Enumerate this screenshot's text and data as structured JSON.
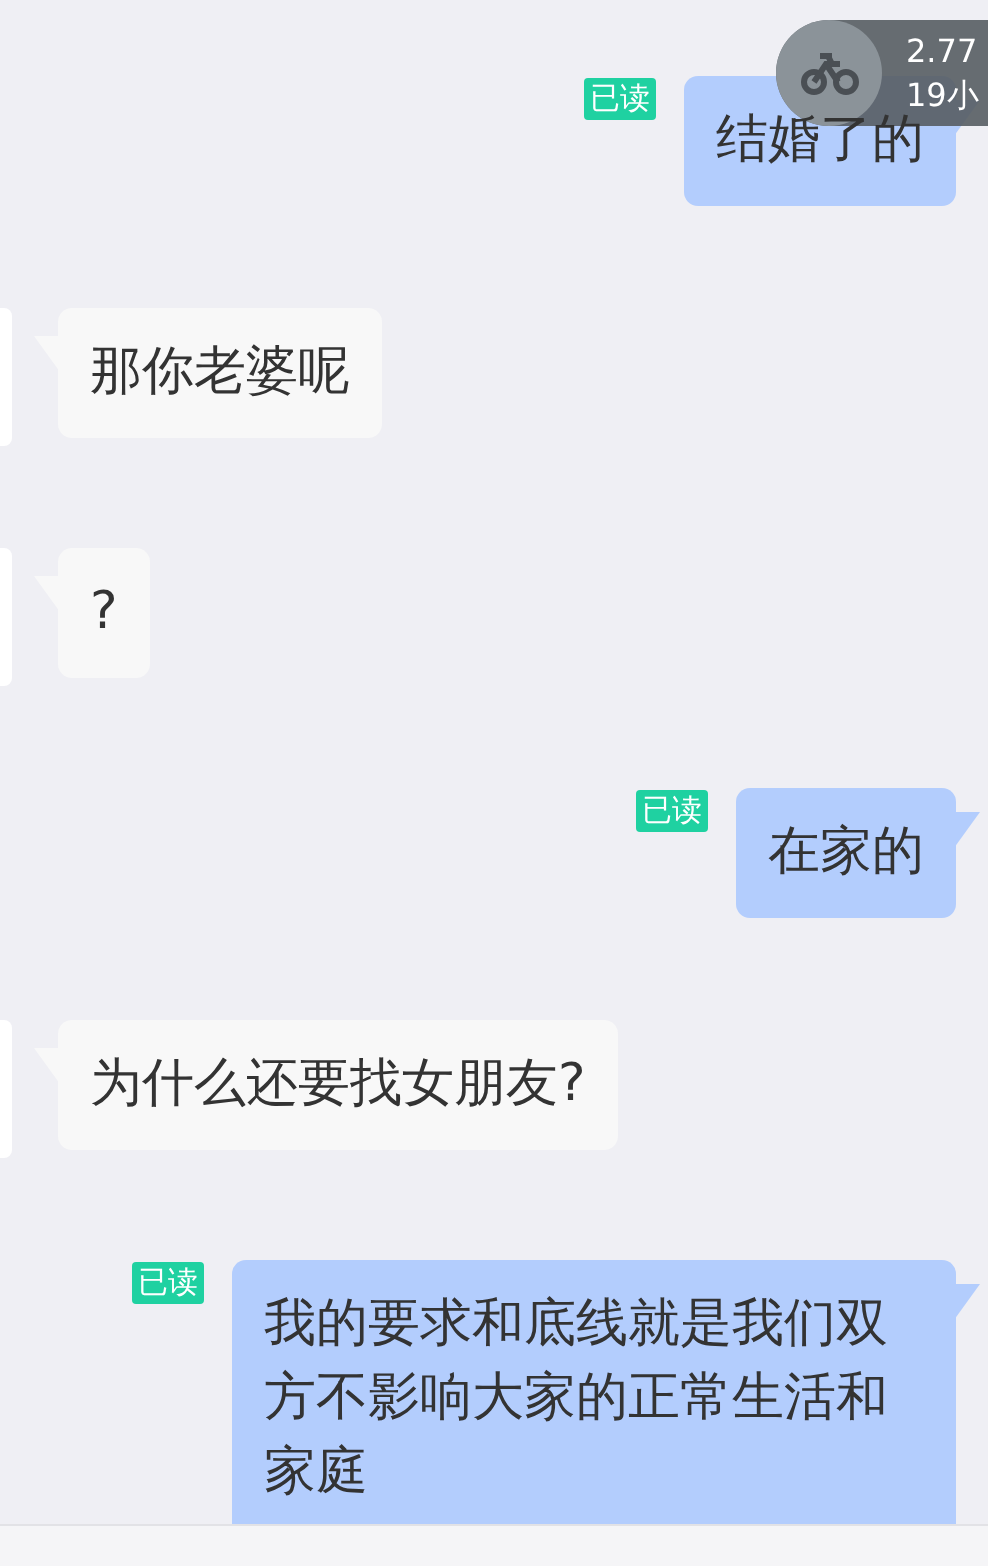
{
  "floating_badge": {
    "lines": [
      "2.77",
      "19小"
    ]
  },
  "messages": [
    {
      "kind": "outgoing",
      "text": "结婚了的",
      "status": "已读"
    },
    {
      "kind": "incoming",
      "text": "那你老婆呢"
    },
    {
      "kind": "incoming",
      "text": "?"
    },
    {
      "kind": "outgoing",
      "text": "在家的",
      "status": "已读"
    },
    {
      "kind": "incoming",
      "text": "为什么还要找女朋友?"
    },
    {
      "kind": "outgoing",
      "text": "我的要求和底线就是我们双方不影响大家的正常生活和家庭",
      "status": "已读"
    }
  ]
}
